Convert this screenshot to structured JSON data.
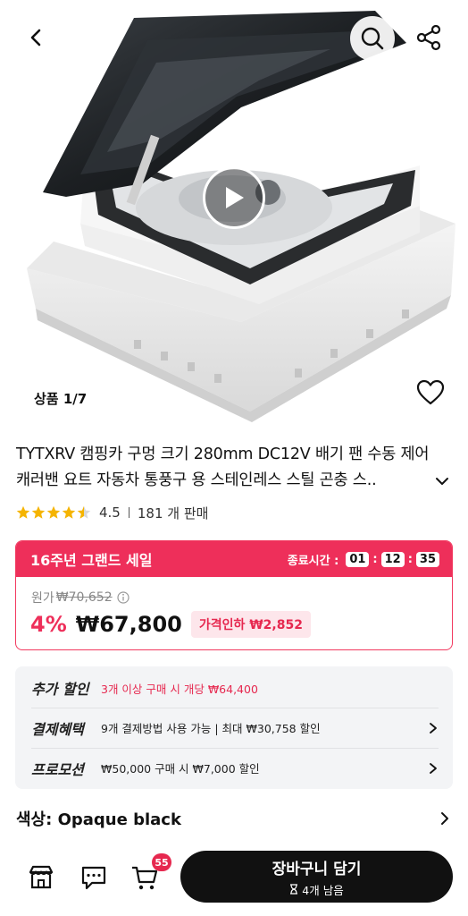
{
  "product": {
    "image_counter": "상품 1/7",
    "title": "TYTXRV 캠핑카 구멍 크기 280mm DC12V 배기 팬 수동 제어 캐러밴 요트 자동차 통풍구 용 스테인레스 스틸 곤충 스..",
    "rating": "4.5",
    "rating_value": 4.5,
    "sold_count": "181 개 판매"
  },
  "sale": {
    "name": "16주년 그랜드 세일",
    "timer_label": "종료시간 :",
    "hours": "01",
    "minutes": "12",
    "seconds": "35",
    "original_label": "원가",
    "original_price": "₩70,652",
    "discount_pct": "4%",
    "price": "₩67,800",
    "price_drop": "가격인하 ₩2,852"
  },
  "benefits": [
    {
      "label": "추가 할인",
      "text": "3개 이상 구매 시 개당 ₩64,400"
    },
    {
      "label": "결제혜택",
      "text": "9개 결제방법 사용 가능 | 최대 ₩30,758 할인"
    },
    {
      "label": "프로모션",
      "text": "₩50,000 구매 시 ₩7,000 할인"
    }
  ],
  "option": {
    "color_label": "색상: Opaque black"
  },
  "bottom_bar": {
    "cart_count": "55",
    "cta_label": "장바구니 담기",
    "cta_sub": "4개 남음"
  },
  "icons": {
    "back": "chevron-left-icon",
    "search": "search-icon",
    "share": "share-icon",
    "play": "play-icon",
    "wishlist": "heart-icon",
    "store": "store-icon",
    "chat": "chat-icon",
    "cart": "cart-icon"
  },
  "colors": {
    "accent": "#ee2f5a",
    "cta": "#111111",
    "benefit_bg": "#f3f4f6"
  }
}
